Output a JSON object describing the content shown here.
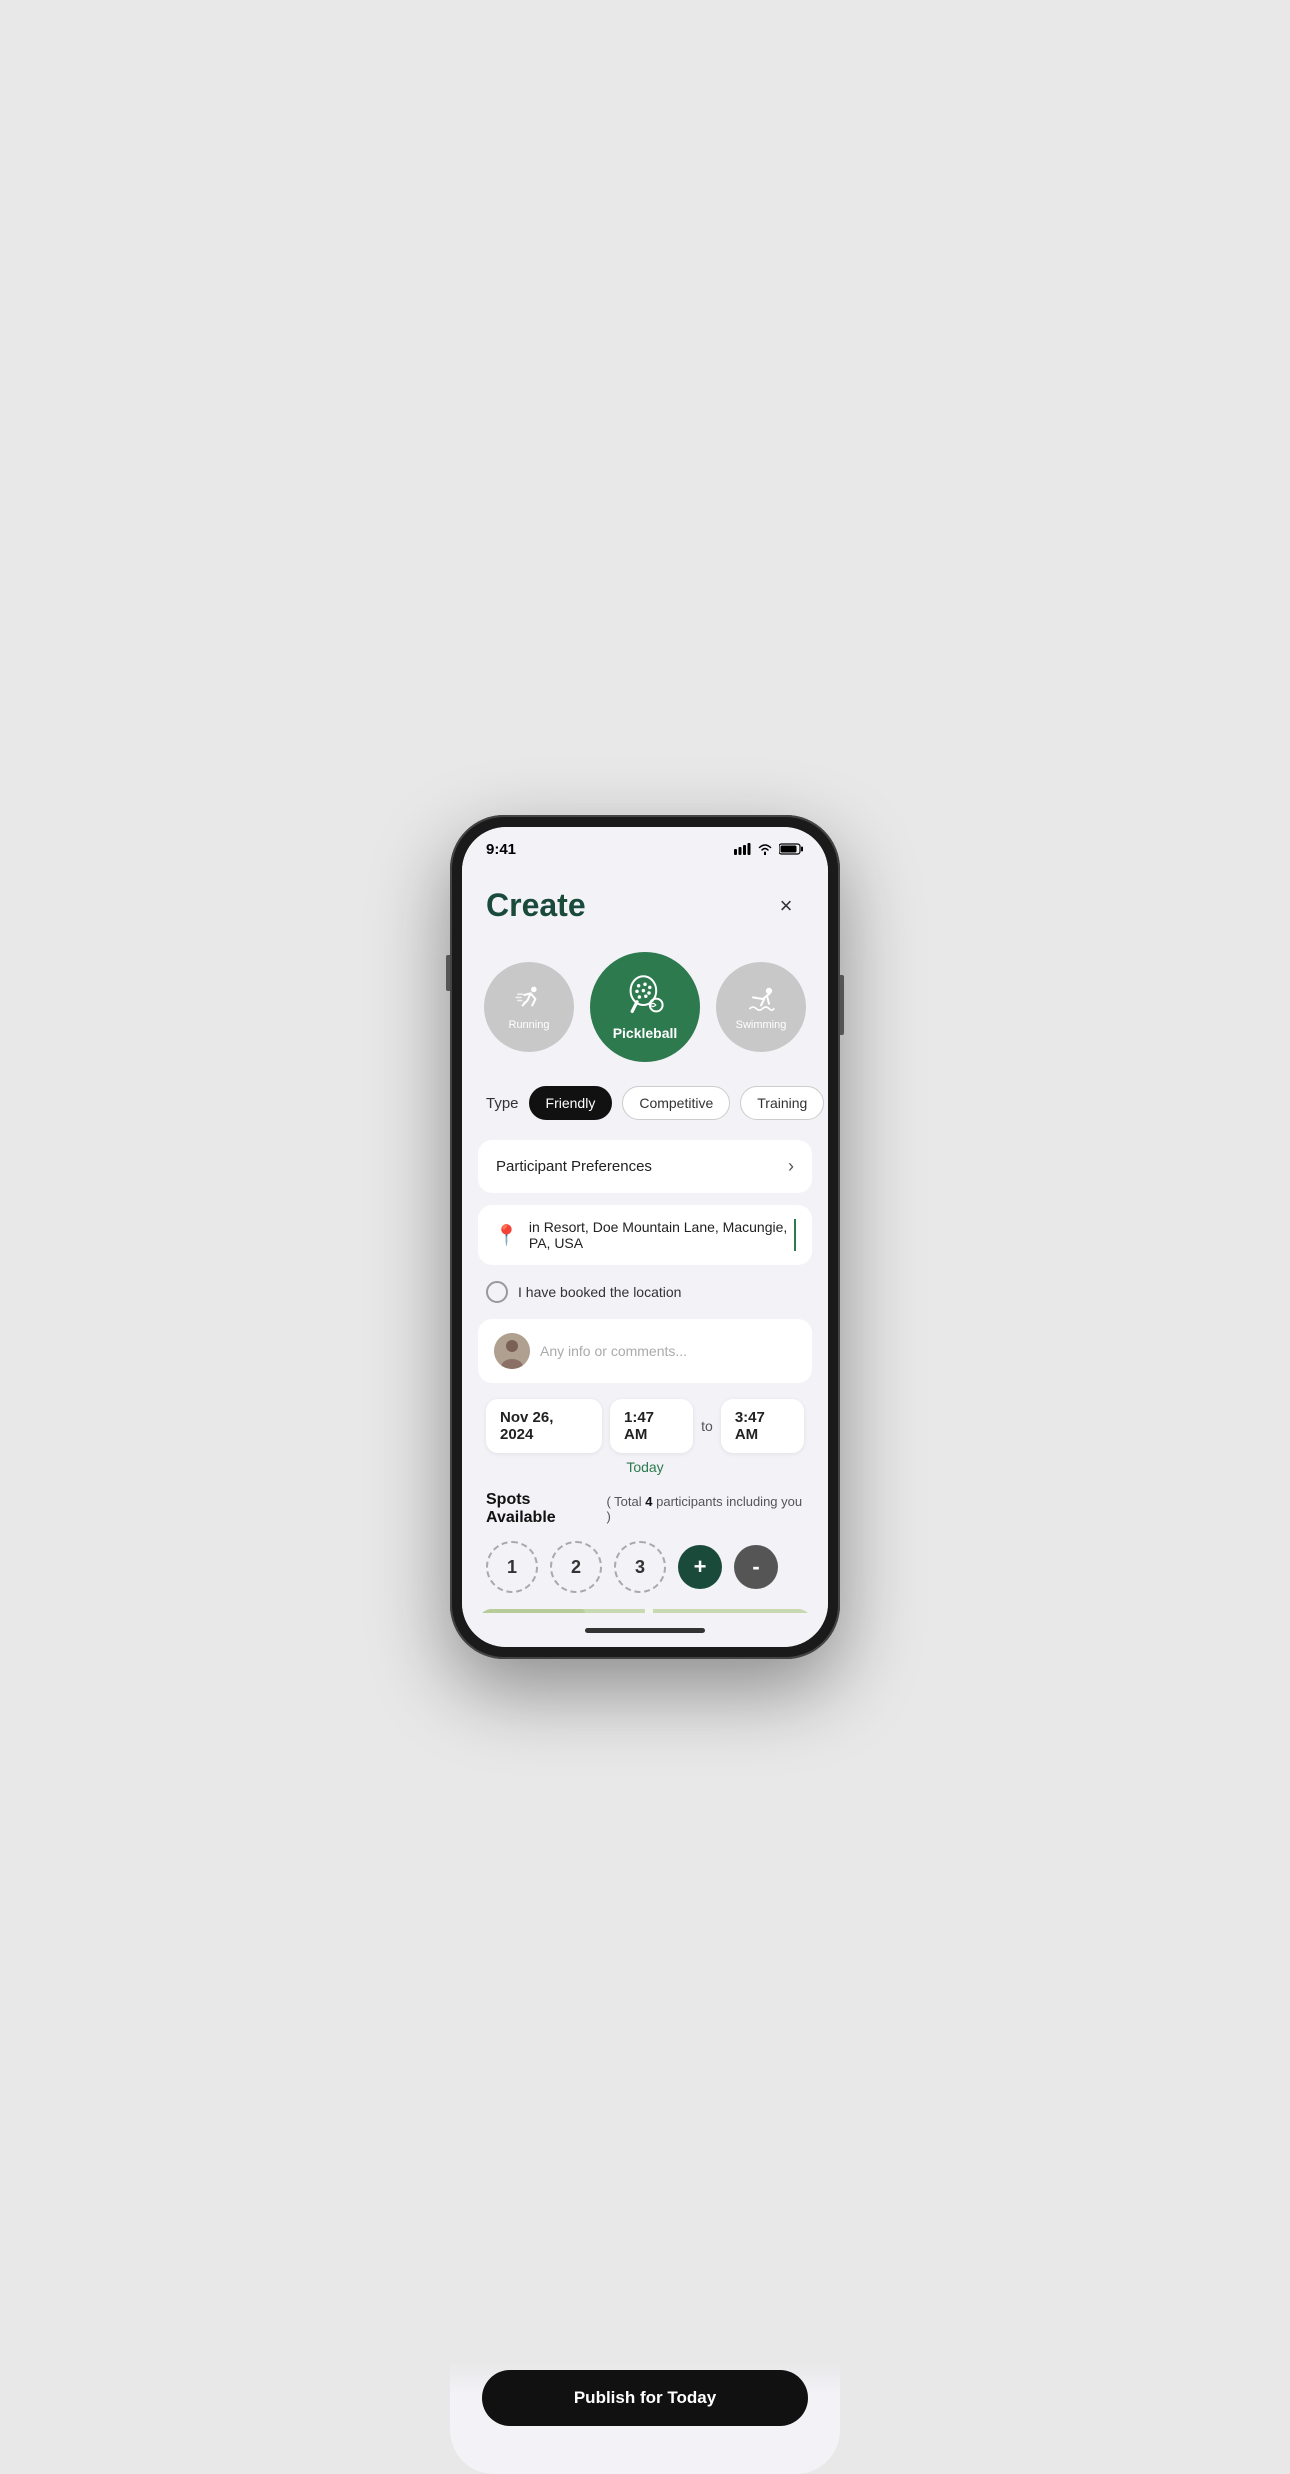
{
  "header": {
    "title": "Create",
    "close_label": "×"
  },
  "sports": [
    {
      "id": "running",
      "label": "Running",
      "active": false
    },
    {
      "id": "pickleball",
      "label": "Pickleball",
      "active": true
    },
    {
      "id": "swimming",
      "label": "Swimming",
      "active": false
    }
  ],
  "type": {
    "label": "Type",
    "options": [
      {
        "id": "friendly",
        "label": "Friendly",
        "active": true
      },
      {
        "id": "competitive",
        "label": "Competitive",
        "active": false
      },
      {
        "id": "training",
        "label": "Training",
        "active": false
      }
    ]
  },
  "participant_preferences": {
    "label": "Participant Preferences"
  },
  "location": {
    "placeholder": "in Resort, Doe Mountain Lane, Macungie, PA, USA"
  },
  "location_booked": {
    "label": "I have booked the location"
  },
  "comments": {
    "placeholder": "Any info or comments..."
  },
  "datetime": {
    "date": "Nov 26, 2024",
    "start": "1:47 AM",
    "to": "to",
    "end": "3:47 AM",
    "today": "Today"
  },
  "spots": {
    "title": "Spots Available",
    "subtitle": "( Total",
    "count": "4",
    "subtitle2": "participants including you )",
    "values": [
      "1",
      "2",
      "3"
    ],
    "plus_label": "+",
    "minus_label": "-"
  },
  "publish": {
    "label": "Publish for Today"
  }
}
